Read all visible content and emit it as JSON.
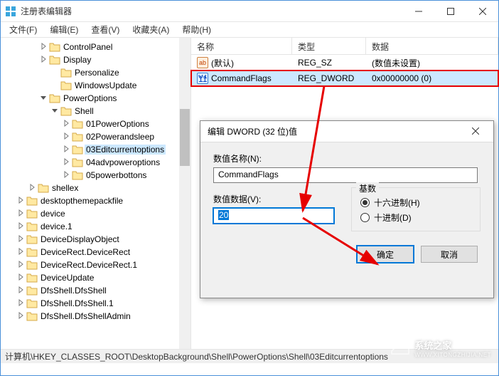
{
  "window": {
    "title": "注册表编辑器"
  },
  "menu": {
    "file": "文件(F)",
    "edit": "编辑(E)",
    "view": "查看(V)",
    "favorites": "收藏夹(A)",
    "help": "帮助(H)"
  },
  "tree": {
    "items": [
      {
        "depth": 3,
        "toggle": ">",
        "label": "ControlPanel"
      },
      {
        "depth": 3,
        "toggle": ">",
        "label": "Display"
      },
      {
        "depth": 4,
        "toggle": "",
        "label": "Personalize"
      },
      {
        "depth": 4,
        "toggle": "",
        "label": "WindowsUpdate"
      },
      {
        "depth": 3,
        "toggle": "v",
        "label": "PowerOptions"
      },
      {
        "depth": 4,
        "toggle": "v",
        "label": "Shell"
      },
      {
        "depth": 5,
        "toggle": ">",
        "label": "01PowerOptions"
      },
      {
        "depth": 5,
        "toggle": ">",
        "label": "02Powerandsleep"
      },
      {
        "depth": 5,
        "toggle": ">",
        "label": "03Editcurrentoptions",
        "selected": true
      },
      {
        "depth": 5,
        "toggle": ">",
        "label": "04advpoweroptions"
      },
      {
        "depth": 5,
        "toggle": ">",
        "label": "05powerbottons"
      },
      {
        "depth": 2,
        "toggle": ">",
        "label": "shellex"
      },
      {
        "depth": 1,
        "toggle": ">",
        "label": "desktopthemepackfile"
      },
      {
        "depth": 1,
        "toggle": ">",
        "label": "device"
      },
      {
        "depth": 1,
        "toggle": ">",
        "label": "device.1"
      },
      {
        "depth": 1,
        "toggle": ">",
        "label": "DeviceDisplayObject"
      },
      {
        "depth": 1,
        "toggle": ">",
        "label": "DeviceRect.DeviceRect"
      },
      {
        "depth": 1,
        "toggle": ">",
        "label": "DeviceRect.DeviceRect.1"
      },
      {
        "depth": 1,
        "toggle": ">",
        "label": "DeviceUpdate"
      },
      {
        "depth": 1,
        "toggle": ">",
        "label": "DfsShell.DfsShell"
      },
      {
        "depth": 1,
        "toggle": ">",
        "label": "DfsShell.DfsShell.1"
      },
      {
        "depth": 1,
        "toggle": ">",
        "label": "DfsShell.DfsShellAdmin"
      }
    ]
  },
  "list": {
    "columns": {
      "name": "名称",
      "type": "类型",
      "data": "数据"
    },
    "col_widths": {
      "name": 142,
      "type": 104,
      "data": 180
    },
    "rows": [
      {
        "icon": "sz",
        "icon_text": "ab",
        "name": "(默认)",
        "type": "REG_SZ",
        "data": "(数值未设置)"
      },
      {
        "icon": "dw",
        "icon_text": "011\n110",
        "name": "CommandFlags",
        "type": "REG_DWORD",
        "data": "0x00000000 (0)",
        "highlighted": true,
        "selected": true
      }
    ]
  },
  "dialog": {
    "title": "编辑 DWORD (32 位)值",
    "name_label": "数值名称(N):",
    "name_value": "CommandFlags",
    "data_label": "数值数据(V):",
    "data_value": "20",
    "base_label": "基数",
    "radio_hex": "十六进制(H)",
    "radio_dec": "十进制(D)",
    "radio_selected": "hex",
    "ok": "确定",
    "cancel": "取消"
  },
  "statusbar": {
    "path": "计算机\\HKEY_CLASSES_ROOT\\DesktopBackground\\Shell\\PowerOptions\\Shell\\03Editcurrentoptions"
  },
  "watermark": {
    "text": "系统之家",
    "url": "WWW.XITONGZHIJIA.NET"
  }
}
